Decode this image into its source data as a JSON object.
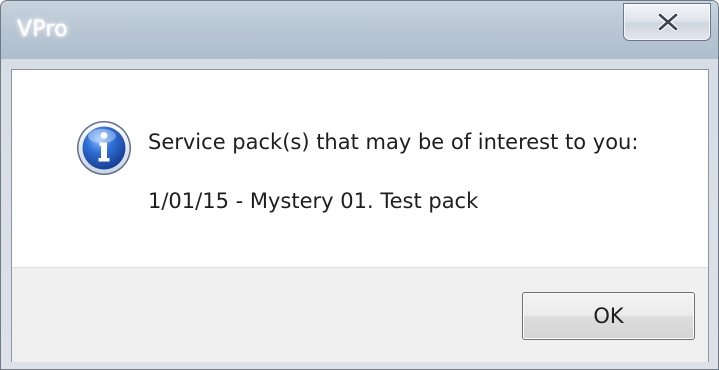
{
  "window": {
    "title": "VPro",
    "close_icon": "close-x-icon"
  },
  "dialog": {
    "icon": "information-icon",
    "message": "Service pack(s) that may be of interest to you:",
    "detail": "1/01/15 - Mystery 01.  Test pack"
  },
  "buttons": {
    "ok_label": "OK"
  },
  "colors": {
    "icon_blue": "#2a63c6",
    "titlebar": "#b8c6d4",
    "footer": "#f0f0f0"
  }
}
